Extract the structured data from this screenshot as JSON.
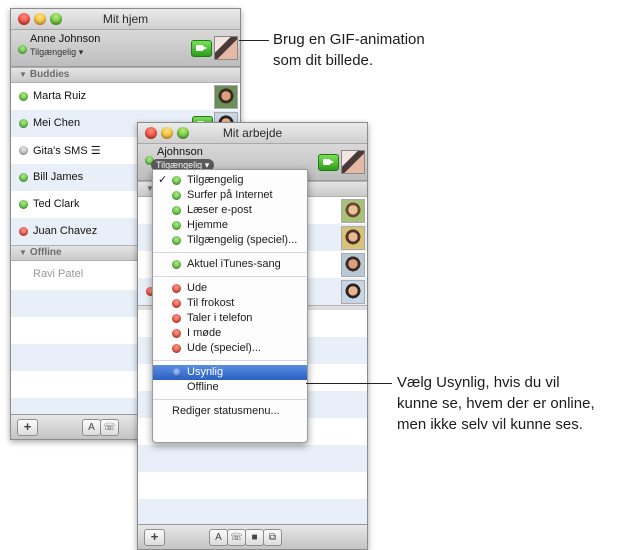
{
  "window1": {
    "title": "Mit hjem",
    "user_name": "Anne Johnson",
    "status": "Tilgængelig ▾",
    "group_buddies": "Buddies",
    "group_offline": "Offline",
    "buddies": [
      {
        "name": "Marta Ruiz",
        "status": "green"
      },
      {
        "name": "Mei Chen",
        "status": "green"
      },
      {
        "name": "Gita's SMS ☰",
        "status": "grey"
      },
      {
        "name": "Bill James",
        "status": "green"
      },
      {
        "name": "Ted Clark",
        "status": "green"
      },
      {
        "name": "Juan Chavez",
        "status": "red"
      }
    ],
    "offline": [
      "Ravi Patel"
    ],
    "bottom_buttons": {
      "add": "+",
      "text": "A"
    }
  },
  "window2": {
    "title": "Mit arbejde",
    "user_name": "Ajohnson",
    "status": "Tilgængelig ▾",
    "bottom_buttons": {
      "add": "+",
      "text": "A"
    }
  },
  "status_menu": {
    "available": [
      {
        "label": "Tilgængelig",
        "checked": "✓"
      },
      {
        "label": "Surfer på Internet"
      },
      {
        "label": "Læser e-post"
      },
      {
        "label": "Hjemme"
      },
      {
        "label": "Tilgængelig (speciel)..."
      }
    ],
    "itunes": "Aktuel iTunes-sang",
    "away": [
      {
        "label": "Ude"
      },
      {
        "label": "Til frokost"
      },
      {
        "label": "Taler i telefon"
      },
      {
        "label": "I møde"
      },
      {
        "label": "Ude (speciel)..."
      }
    ],
    "invisible": "Usynlig",
    "offline": "Offline",
    "edit": "Rediger statusmenu..."
  },
  "callouts": {
    "gif_line1": "Brug en GIF-animation",
    "gif_line2": "som dit billede.",
    "invisible_line1": "Vælg Usynlig, hvis du vil",
    "invisible_line2": "kunne se, hvem der er online,",
    "invisible_line3": "men ikke selv vil kunne ses."
  },
  "colors": {
    "selection": "#2b5fc4",
    "available": "#3fa428",
    "away": "#d02a1c"
  }
}
